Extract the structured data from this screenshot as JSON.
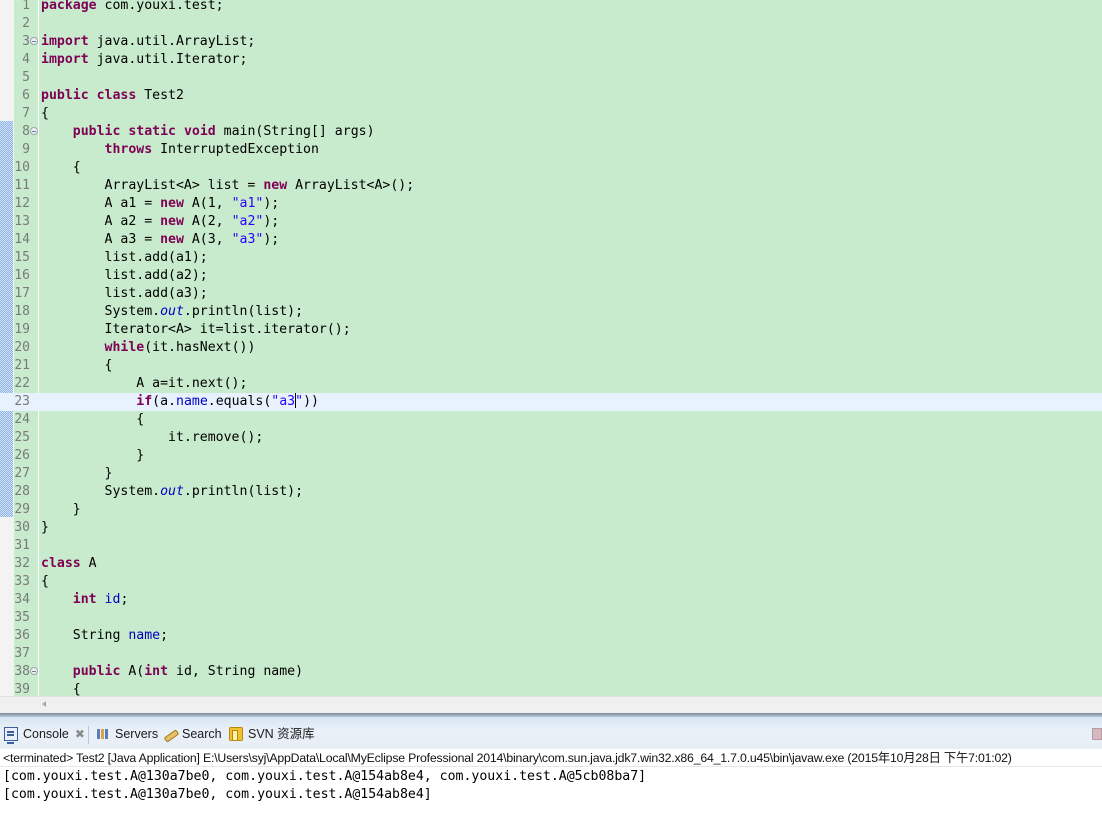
{
  "editor": {
    "current_line": 23,
    "caret_after": "\"a3",
    "lines": [
      {
        "n": 1,
        "fold": false,
        "tokens": [
          {
            "t": "package",
            "k": "kw"
          },
          {
            "t": " com.youxi.test;"
          }
        ]
      },
      {
        "n": 2,
        "fold": false,
        "tokens": []
      },
      {
        "n": 3,
        "fold": true,
        "tokens": [
          {
            "t": "import",
            "k": "kw"
          },
          {
            "t": " java.util.ArrayList;"
          }
        ]
      },
      {
        "n": 4,
        "fold": false,
        "tokens": [
          {
            "t": "import",
            "k": "kw"
          },
          {
            "t": " java.util.Iterator;"
          }
        ]
      },
      {
        "n": 5,
        "fold": false,
        "tokens": []
      },
      {
        "n": 6,
        "fold": false,
        "tokens": [
          {
            "t": "public",
            "k": "kw"
          },
          {
            "t": " "
          },
          {
            "t": "class",
            "k": "kw"
          },
          {
            "t": " Test2"
          }
        ]
      },
      {
        "n": 7,
        "fold": false,
        "tokens": [
          {
            "t": "{"
          }
        ]
      },
      {
        "n": 8,
        "fold": true,
        "tokens": [
          {
            "t": "    "
          },
          {
            "t": "public",
            "k": "kw"
          },
          {
            "t": " "
          },
          {
            "t": "static",
            "k": "kw"
          },
          {
            "t": " "
          },
          {
            "t": "void",
            "k": "kw"
          },
          {
            "t": " main(String[] args)"
          }
        ]
      },
      {
        "n": 9,
        "fold": false,
        "tokens": [
          {
            "t": "        "
          },
          {
            "t": "throws",
            "k": "kw"
          },
          {
            "t": " InterruptedException"
          }
        ]
      },
      {
        "n": 10,
        "fold": false,
        "tokens": [
          {
            "t": "    {"
          }
        ]
      },
      {
        "n": 11,
        "fold": false,
        "tokens": [
          {
            "t": "        ArrayList<A> list = "
          },
          {
            "t": "new",
            "k": "kw"
          },
          {
            "t": " ArrayList<A>();"
          }
        ]
      },
      {
        "n": 12,
        "fold": false,
        "tokens": [
          {
            "t": "        A a1 = "
          },
          {
            "t": "new",
            "k": "kw"
          },
          {
            "t": " A(1, "
          },
          {
            "t": "\"a1\"",
            "k": "str"
          },
          {
            "t": ");"
          }
        ]
      },
      {
        "n": 13,
        "fold": false,
        "tokens": [
          {
            "t": "        A a2 = "
          },
          {
            "t": "new",
            "k": "kw"
          },
          {
            "t": " A(2, "
          },
          {
            "t": "\"a2\"",
            "k": "str"
          },
          {
            "t": ");"
          }
        ]
      },
      {
        "n": 14,
        "fold": false,
        "tokens": [
          {
            "t": "        A a3 = "
          },
          {
            "t": "new",
            "k": "kw"
          },
          {
            "t": " A(3, "
          },
          {
            "t": "\"a3\"",
            "k": "str"
          },
          {
            "t": ");"
          }
        ]
      },
      {
        "n": 15,
        "fold": false,
        "tokens": [
          {
            "t": "        list.add(a1);"
          }
        ]
      },
      {
        "n": 16,
        "fold": false,
        "tokens": [
          {
            "t": "        list.add(a2);"
          }
        ]
      },
      {
        "n": 17,
        "fold": false,
        "tokens": [
          {
            "t": "        list.add(a3);"
          }
        ]
      },
      {
        "n": 18,
        "fold": false,
        "tokens": [
          {
            "t": "        System."
          },
          {
            "t": "out",
            "k": "static"
          },
          {
            "t": ".println(list);"
          }
        ]
      },
      {
        "n": 19,
        "fold": false,
        "tokens": [
          {
            "t": "        Iterator<A> it=list.iterator();"
          }
        ]
      },
      {
        "n": 20,
        "fold": false,
        "tokens": [
          {
            "t": "        "
          },
          {
            "t": "while",
            "k": "kw"
          },
          {
            "t": "(it.hasNext())"
          }
        ]
      },
      {
        "n": 21,
        "fold": false,
        "tokens": [
          {
            "t": "        {"
          }
        ]
      },
      {
        "n": 22,
        "fold": false,
        "tokens": [
          {
            "t": "            A a=it.next();"
          }
        ]
      },
      {
        "n": 23,
        "fold": false,
        "tokens": [
          {
            "t": "            "
          },
          {
            "t": "if",
            "k": "kw"
          },
          {
            "t": "(a."
          },
          {
            "t": "name",
            "k": "field"
          },
          {
            "t": ".equals("
          },
          {
            "t": "\"a3",
            "k": "str"
          },
          {
            "t": "",
            "k": "caret"
          },
          {
            "t": "\"",
            "k": "str"
          },
          {
            "t": "))"
          }
        ]
      },
      {
        "n": 24,
        "fold": false,
        "tokens": [
          {
            "t": "            {"
          }
        ]
      },
      {
        "n": 25,
        "fold": false,
        "tokens": [
          {
            "t": "                it.remove();"
          }
        ]
      },
      {
        "n": 26,
        "fold": false,
        "tokens": [
          {
            "t": "            }"
          }
        ]
      },
      {
        "n": 27,
        "fold": false,
        "tokens": [
          {
            "t": "        }"
          }
        ]
      },
      {
        "n": 28,
        "fold": false,
        "tokens": [
          {
            "t": "        System."
          },
          {
            "t": "out",
            "k": "static"
          },
          {
            "t": ".println(list);"
          }
        ]
      },
      {
        "n": 29,
        "fold": false,
        "tokens": [
          {
            "t": "    }"
          }
        ]
      },
      {
        "n": 30,
        "fold": false,
        "tokens": [
          {
            "t": "}"
          }
        ]
      },
      {
        "n": 31,
        "fold": false,
        "tokens": []
      },
      {
        "n": 32,
        "fold": false,
        "tokens": [
          {
            "t": "class",
            "k": "kw"
          },
          {
            "t": " A"
          }
        ]
      },
      {
        "n": 33,
        "fold": false,
        "tokens": [
          {
            "t": "{"
          }
        ]
      },
      {
        "n": 34,
        "fold": false,
        "tokens": [
          {
            "t": "    "
          },
          {
            "t": "int",
            "k": "kw"
          },
          {
            "t": " "
          },
          {
            "t": "id",
            "k": "field"
          },
          {
            "t": ";"
          }
        ]
      },
      {
        "n": 35,
        "fold": false,
        "tokens": []
      },
      {
        "n": 36,
        "fold": false,
        "tokens": [
          {
            "t": "    String "
          },
          {
            "t": "name",
            "k": "field"
          },
          {
            "t": ";"
          }
        ]
      },
      {
        "n": 37,
        "fold": false,
        "tokens": []
      },
      {
        "n": 38,
        "fold": true,
        "tokens": [
          {
            "t": "    "
          },
          {
            "t": "public",
            "k": "kw"
          },
          {
            "t": " A("
          },
          {
            "t": "int",
            "k": "kw"
          },
          {
            "t": " id, String name)"
          }
        ]
      },
      {
        "n": 39,
        "fold": false,
        "tokens": [
          {
            "t": "    {"
          }
        ]
      }
    ]
  },
  "console_view": {
    "tabs": [
      {
        "label": "Console",
        "icon": "console-icon",
        "active": true,
        "closable": true
      },
      {
        "label": "Servers",
        "icon": "servers-icon",
        "active": false
      },
      {
        "label": "Search",
        "icon": "search-icon",
        "active": false
      },
      {
        "label": "SVN 资源库",
        "icon": "svn-repository-icon",
        "active": false
      }
    ],
    "close_glyph": "✖",
    "status": "<terminated> Test2 [Java Application] E:\\Users\\syj\\AppData\\Local\\MyEclipse Professional 2014\\binary\\com.sun.java.jdk7.win32.x86_64_1.7.0.u45\\bin\\javaw.exe (2015年10月28日 下午7:01:02)",
    "output": [
      "[com.youxi.test.A@130a7be0, com.youxi.test.A@154ab8e4, com.youxi.test.A@5cb08ba7]",
      "[com.youxi.test.A@130a7be0, com.youxi.test.A@154ab8e4]"
    ]
  },
  "colors": {
    "editor_bg": "#c7ebcc",
    "current_line_bg": "#e8f2fe",
    "keyword": "#7f0055",
    "string": "#2a00ff",
    "field": "#0000c0"
  }
}
